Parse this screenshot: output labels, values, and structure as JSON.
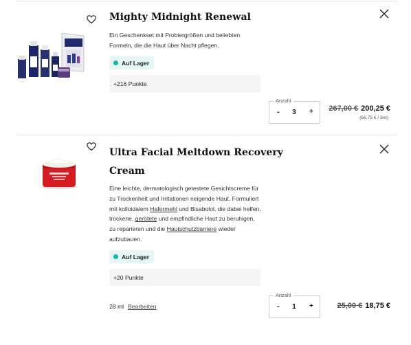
{
  "items": [
    {
      "title": "Mighty Midnight Renewal",
      "description": "Ein Geschenkset mit Probiergrößen und beliebten Formeln, die die Haut über Nacht pflegen.",
      "stock": "Auf Lager",
      "points": "+216 Punkte",
      "quantity_label": "Anzahl",
      "quantity": "3",
      "minus": "-",
      "plus": "+",
      "old_price": "267,00 €",
      "new_price": "200,25 €",
      "unit_price": "(66,75 € / Set)"
    },
    {
      "title_line1": "Ultra Facial Meltdown Recovery",
      "title_line2": "Cream",
      "desc_1": "Eine leichte, dermatologisch getestete Gesichtscreme für zu Trockenheit und Irritationen neigende Haut. Formuliert mit kolloidalem ",
      "desc_link_1": "Hafermehl",
      "desc_2": " und Bisabolol, die dabei helfen, trockene, ",
      "desc_link_2": "gerötete",
      "desc_3": " und empfindliche Haut zu beruhigen, zu reparieren und die ",
      "desc_link_3": "Hautschutzbarriere",
      "desc_4": " wieder aufzubauen.",
      "stock": "Auf Lager",
      "points": "+20 Punkte",
      "size": "28 ml",
      "edit": "Bearbeiten",
      "quantity_label": "Anzahl",
      "quantity": "1",
      "minus": "-",
      "plus": "+",
      "old_price": "25,00 €",
      "new_price": "18,75 €"
    }
  ],
  "icons": {
    "wishlist": "heart-outline-icon",
    "remove": "close-icon"
  },
  "colors": {
    "stock_dot": "#12b9a6",
    "stock_bg": "#e6f6f5",
    "points_bg": "#f5f5f5"
  }
}
